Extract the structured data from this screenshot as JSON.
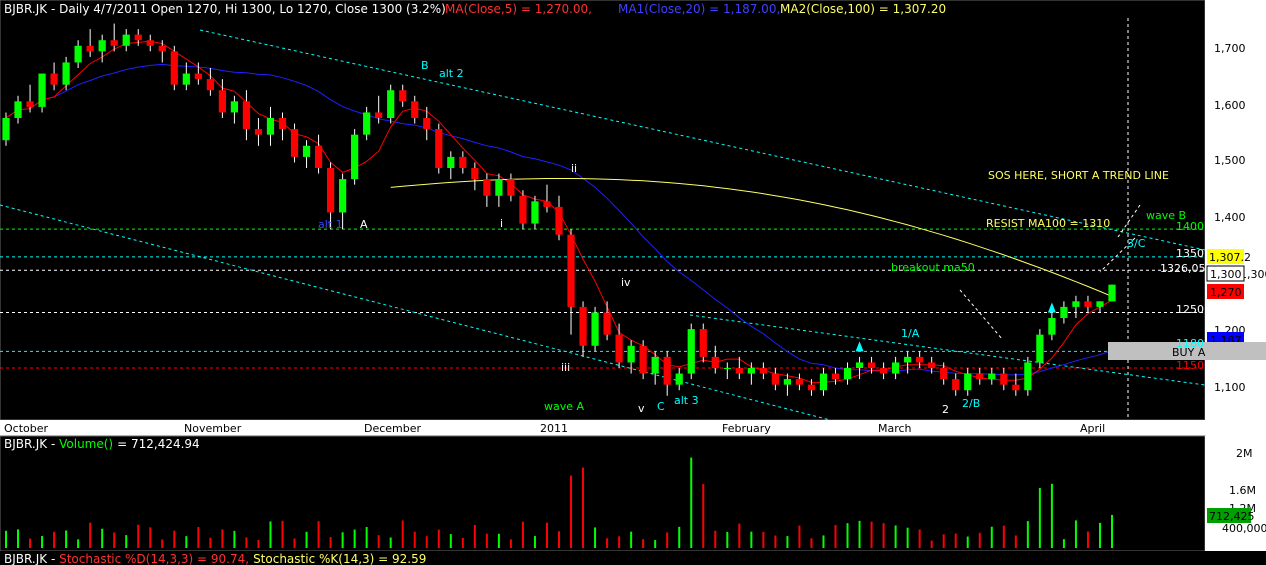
{
  "header": {
    "symbol": "BJBR.JK",
    "summary": "BJBR.JK - Daily 4/7/2011 Open 1270, Hi 1300, Lo 1270, Close 1300 (3.2%)",
    "ma_label": "MA(Close,5) = 1,270.00,",
    "ma1_label": "MA1(Close,20) = 1,187.00,",
    "ma2_label": "MA2(Close,100) = 1,307.20"
  },
  "volume_panel": {
    "title": "BJBR.JK - Volume() = 712,424.94",
    "prefix": "BJBR.JK - ",
    "name": "Volume()",
    "value": "= 712,424.94"
  },
  "stoch_panel": {
    "prefix": "BJBR.JK - ",
    "d_label": "Stochastic %D(14,3,3) = 90.74,",
    "k_label": "Stochastic %K(14,3) = 92.59"
  },
  "price_axis": {
    "ticks": [
      "1,700",
      "1,600",
      "1,500",
      "1,400",
      "1,300",
      "1,200",
      "1,100"
    ],
    "tags": {
      "ma2": "1,307.2",
      "close": "1,300",
      "ma5": "1,270",
      "ma20": "1,187",
      "buy": "BUY A"
    }
  },
  "volume_axis": {
    "ticks": [
      "2M",
      "1.6M",
      "1.2M",
      "800,000",
      "400,000"
    ],
    "tag": "712,425"
  },
  "time_axis": {
    "labels": [
      "October",
      "November",
      "December",
      "2011",
      "February",
      "March",
      "April"
    ]
  },
  "levels": {
    "l1400": "1400",
    "l1350": "1350",
    "l1326": "1326,05",
    "l1250": "1250",
    "l1180": "1180",
    "l1150": "1150"
  },
  "annotations": {
    "sos": "SOS HERE, SHORT A TREND LINE",
    "resist": "RESIST MA100 = 1310",
    "waveB": "wave B",
    "c3": "3/C",
    "breakout": "breakout ma50",
    "a1": "1/A",
    "b2": "2/B",
    "n2": "2",
    "waveA": "wave A",
    "v": "v",
    "c": "C",
    "alt3": "alt 3",
    "iii": "iii",
    "iv": "iv",
    "ii": "ii",
    "i": "i",
    "alt1": "alt 1",
    "A": "A",
    "B": "B",
    "alt2": "alt 2"
  },
  "colors": {
    "up": "#00FF00",
    "down": "#FF0000",
    "ma5": "#FF0000",
    "ma20": "#2020FF",
    "ma100": "#FFFF66",
    "grid": "#00FFFF",
    "header_green": "#00FF00"
  },
  "chart_data": {
    "type": "candlestick",
    "title": "BJBR.JK - Daily 4/7/2011",
    "ylim": [
      1060,
      1780
    ],
    "series": [
      {
        "name": "price",
        "ohlc": [
          [
            1560,
            1610,
            1550,
            1600
          ],
          [
            1600,
            1640,
            1590,
            1630
          ],
          [
            1630,
            1660,
            1610,
            1620
          ],
          [
            1620,
            1680,
            1610,
            1680
          ],
          [
            1680,
            1700,
            1650,
            1660
          ],
          [
            1660,
            1710,
            1650,
            1700
          ],
          [
            1700,
            1740,
            1690,
            1730
          ],
          [
            1730,
            1760,
            1710,
            1720
          ],
          [
            1720,
            1750,
            1700,
            1740
          ],
          [
            1740,
            1770,
            1720,
            1730
          ],
          [
            1730,
            1760,
            1720,
            1750
          ],
          [
            1750,
            1760,
            1730,
            1740
          ],
          [
            1740,
            1750,
            1720,
            1730
          ],
          [
            1730,
            1740,
            1700,
            1720
          ],
          [
            1720,
            1730,
            1650,
            1660
          ],
          [
            1660,
            1700,
            1650,
            1680
          ],
          [
            1680,
            1700,
            1660,
            1670
          ],
          [
            1670,
            1690,
            1640,
            1650
          ],
          [
            1650,
            1670,
            1600,
            1610
          ],
          [
            1610,
            1640,
            1590,
            1630
          ],
          [
            1630,
            1650,
            1560,
            1580
          ],
          [
            1580,
            1600,
            1550,
            1570
          ],
          [
            1570,
            1620,
            1550,
            1600
          ],
          [
            1600,
            1610,
            1560,
            1580
          ],
          [
            1580,
            1590,
            1520,
            1530
          ],
          [
            1530,
            1560,
            1510,
            1550
          ],
          [
            1550,
            1570,
            1500,
            1510
          ],
          [
            1510,
            1520,
            1400,
            1430
          ],
          [
            1430,
            1500,
            1400,
            1490
          ],
          [
            1490,
            1580,
            1480,
            1570
          ],
          [
            1570,
            1620,
            1560,
            1610
          ],
          [
            1610,
            1640,
            1590,
            1600
          ],
          [
            1600,
            1660,
            1590,
            1650
          ],
          [
            1650,
            1660,
            1620,
            1630
          ],
          [
            1630,
            1640,
            1590,
            1600
          ],
          [
            1600,
            1620,
            1560,
            1580
          ],
          [
            1580,
            1590,
            1500,
            1510
          ],
          [
            1510,
            1540,
            1490,
            1530
          ],
          [
            1530,
            1540,
            1500,
            1510
          ],
          [
            1510,
            1520,
            1470,
            1490
          ],
          [
            1490,
            1500,
            1440,
            1460
          ],
          [
            1460,
            1500,
            1440,
            1490
          ],
          [
            1490,
            1500,
            1450,
            1460
          ],
          [
            1460,
            1470,
            1400,
            1410
          ],
          [
            1410,
            1460,
            1400,
            1450
          ],
          [
            1450,
            1480,
            1430,
            1440
          ],
          [
            1440,
            1460,
            1380,
            1390
          ],
          [
            1390,
            1400,
            1210,
            1260
          ],
          [
            1260,
            1270,
            1170,
            1190
          ],
          [
            1190,
            1260,
            1180,
            1250
          ],
          [
            1250,
            1270,
            1200,
            1210
          ],
          [
            1210,
            1230,
            1150,
            1160
          ],
          [
            1160,
            1200,
            1140,
            1190
          ],
          [
            1190,
            1200,
            1130,
            1140
          ],
          [
            1140,
            1180,
            1120,
            1170
          ],
          [
            1170,
            1180,
            1100,
            1120
          ],
          [
            1120,
            1150,
            1110,
            1140
          ],
          [
            1140,
            1230,
            1130,
            1220
          ],
          [
            1220,
            1230,
            1160,
            1170
          ],
          [
            1170,
            1190,
            1140,
            1150
          ],
          [
            1150,
            1160,
            1130,
            1150
          ],
          [
            1150,
            1170,
            1130,
            1140
          ],
          [
            1140,
            1160,
            1120,
            1150
          ],
          [
            1150,
            1160,
            1130,
            1140
          ],
          [
            1140,
            1150,
            1110,
            1120
          ],
          [
            1120,
            1140,
            1100,
            1130
          ],
          [
            1130,
            1140,
            1110,
            1120
          ],
          [
            1120,
            1130,
            1100,
            1110
          ],
          [
            1110,
            1150,
            1100,
            1140
          ],
          [
            1140,
            1150,
            1120,
            1130
          ],
          [
            1130,
            1160,
            1120,
            1150
          ],
          [
            1150,
            1170,
            1130,
            1160
          ],
          [
            1160,
            1170,
            1140,
            1150
          ],
          [
            1150,
            1160,
            1130,
            1140
          ],
          [
            1140,
            1170,
            1130,
            1160
          ],
          [
            1160,
            1180,
            1140,
            1170
          ],
          [
            1170,
            1180,
            1150,
            1160
          ],
          [
            1160,
            1170,
            1140,
            1150
          ],
          [
            1150,
            1160,
            1120,
            1130
          ],
          [
            1130,
            1140,
            1100,
            1110
          ],
          [
            1110,
            1150,
            1100,
            1140
          ],
          [
            1140,
            1150,
            1120,
            1130
          ],
          [
            1130,
            1150,
            1120,
            1140
          ],
          [
            1140,
            1150,
            1110,
            1120
          ],
          [
            1120,
            1140,
            1100,
            1110
          ],
          [
            1110,
            1170,
            1100,
            1160
          ],
          [
            1160,
            1220,
            1150,
            1210
          ],
          [
            1210,
            1250,
            1200,
            1240
          ],
          [
            1240,
            1270,
            1230,
            1260
          ],
          [
            1260,
            1280,
            1240,
            1270
          ],
          [
            1270,
            1280,
            1250,
            1260
          ],
          [
            1260,
            1270,
            1250,
            1270
          ],
          [
            1270,
            1300,
            1270,
            1300
          ]
        ]
      },
      {
        "name": "MA(Close,5)",
        "last": 1270
      },
      {
        "name": "MA1(Close,20)",
        "last": 1187
      },
      {
        "name": "MA2(Close,100)",
        "last": 1307.2
      }
    ]
  }
}
